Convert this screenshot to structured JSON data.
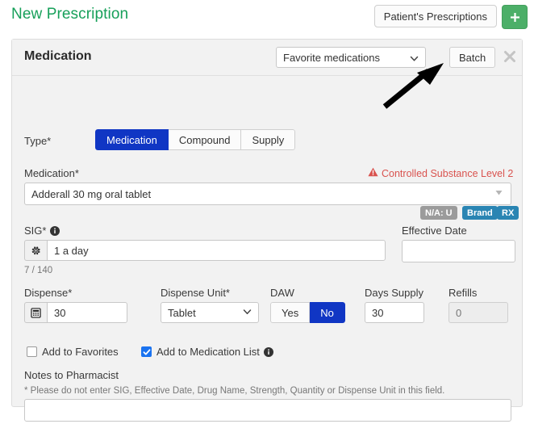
{
  "topbar": {
    "title": "New Prescription",
    "patient_prescriptions_label": "Patient's Prescriptions",
    "add_icon": "plus-icon",
    "add_color": "#4caf68",
    "title_color": "#17a05a"
  },
  "card": {
    "header": {
      "title": "Medication",
      "favorite_select_value": "Favorite medications",
      "batch_label": "Batch",
      "close_icon": "close-icon"
    },
    "type": {
      "label": "Type*",
      "options": [
        {
          "label": "Medication",
          "selected": true
        },
        {
          "label": "Compound",
          "selected": false
        },
        {
          "label": "Supply",
          "selected": false
        }
      ],
      "selected_color": "#1036c4"
    },
    "medication": {
      "label": "Medication*",
      "value": "Adderall 30 mg oral tablet",
      "warning_text": "Controlled Substance Level 2",
      "warning_icon": "warning-triangle-icon",
      "warning_color": "#d9534f",
      "dropdown_icon": "caret-down-icon",
      "badges": [
        {
          "text": "N/A: U",
          "color": "#9b9b9b"
        },
        {
          "text": "Brand",
          "color": "#2a85b3"
        },
        {
          "text": "RX",
          "color": "#2a85b3"
        }
      ]
    },
    "sig": {
      "label": "SIG*",
      "info_icon": "info-icon",
      "gear_icon": "gear-icon",
      "value": "1 a day",
      "counter": "7 / 140"
    },
    "effective_date": {
      "label": "Effective Date",
      "value": ""
    },
    "dispense": {
      "label": "Dispense*",
      "calculator_icon": "calculator-icon",
      "value": "30"
    },
    "dispense_unit": {
      "label": "Dispense Unit*",
      "value": "Tablet",
      "dropdown_icon": "chevron-down-icon"
    },
    "daw": {
      "label": "DAW",
      "options": [
        {
          "label": "Yes",
          "selected": false
        },
        {
          "label": "No",
          "selected": true
        }
      ]
    },
    "days_supply": {
      "label": "Days Supply",
      "value": "30"
    },
    "refills": {
      "label": "Refills",
      "value": "0",
      "disabled": true
    },
    "add_to_favorites": {
      "label": "Add to Favorites",
      "checked": false
    },
    "add_to_medication_list": {
      "label": "Add to Medication List",
      "checked": true,
      "info_icon": "info-icon"
    },
    "notes": {
      "label": "Notes to Pharmacist",
      "hint": "* Please do not enter SIG, Effective Date, Drug Name, Strength, Quantity or Dispense Unit in this field.",
      "value": ""
    }
  },
  "annotation": {
    "arrow_icon": "pointer-arrow-icon",
    "arrow_color": "#000000"
  }
}
